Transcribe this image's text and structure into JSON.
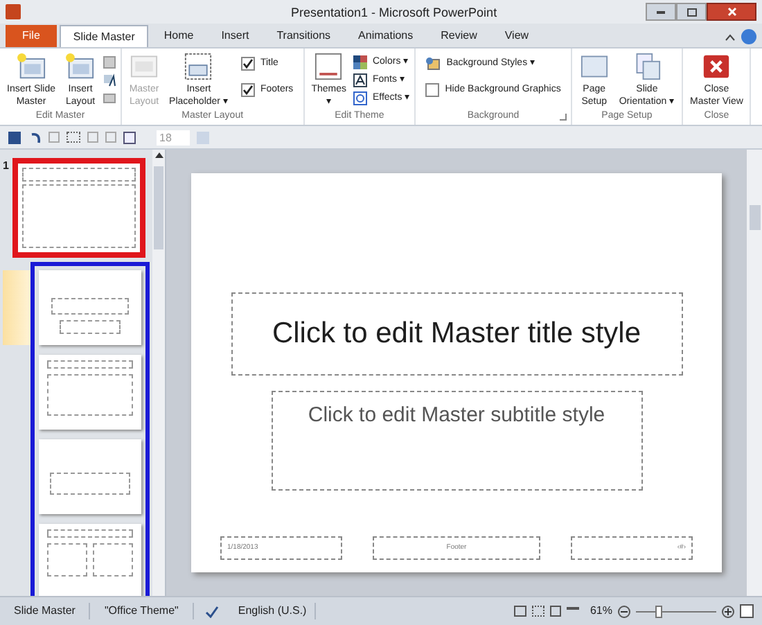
{
  "window": {
    "title": "Presentation1 - Microsoft PowerPoint"
  },
  "tabs": [
    {
      "label": "File",
      "kind": "file",
      "selected": false
    },
    {
      "label": "Slide Master",
      "kind": "tab",
      "selected": true
    },
    {
      "label": "Home",
      "kind": "tab",
      "selected": false
    },
    {
      "label": "Insert",
      "kind": "tab",
      "selected": false
    },
    {
      "label": "Transitions",
      "kind": "tab",
      "selected": false
    },
    {
      "label": "Animations",
      "kind": "tab",
      "selected": false
    },
    {
      "label": "Review",
      "kind": "tab",
      "selected": false
    },
    {
      "label": "View",
      "kind": "tab",
      "selected": false
    }
  ],
  "ribbon": {
    "groups": [
      {
        "name": "Edit Master",
        "launcher": false,
        "items": [
          {
            "kind": "large",
            "lines": [
              "Insert Slide",
              "Master"
            ],
            "disabled": false
          },
          {
            "kind": "large",
            "lines": [
              "Insert",
              "Layout"
            ],
            "disabled": false
          },
          {
            "kind": "smallicons"
          }
        ]
      },
      {
        "name": "Master Layout",
        "launcher": false,
        "items": [
          {
            "kind": "large",
            "lines": [
              "Master",
              "Layout"
            ],
            "disabled": true
          },
          {
            "kind": "large",
            "lines": [
              "Insert",
              "Placeholder ▾"
            ],
            "disabled": false
          },
          {
            "kind": "checks",
            "checks": [
              {
                "label": "Title",
                "checked": true
              },
              {
                "label": "Footers",
                "checked": true
              }
            ]
          }
        ]
      },
      {
        "name": "Edit Theme",
        "launcher": false,
        "items": [
          {
            "kind": "large",
            "lines": [
              "Themes",
              "▾"
            ],
            "disabled": false
          },
          {
            "kind": "menu",
            "entries": [
              {
                "label": "Colors ▾"
              },
              {
                "label": "Fonts ▾"
              },
              {
                "label": "Effects ▾"
              }
            ]
          }
        ]
      },
      {
        "name": "Background",
        "launcher": true,
        "items": [
          {
            "kind": "bgstack",
            "entries": [
              {
                "kind": "menu",
                "label": "Background Styles ▾"
              },
              {
                "kind": "check",
                "label": "Hide Background Graphics",
                "checked": false
              }
            ]
          }
        ]
      },
      {
        "name": "Page Setup",
        "launcher": false,
        "items": [
          {
            "kind": "large",
            "lines": [
              "Page",
              "Setup"
            ],
            "disabled": false
          },
          {
            "kind": "large",
            "lines": [
              "Slide",
              "Orientation ▾"
            ],
            "disabled": false
          }
        ]
      },
      {
        "name": "Close",
        "launcher": false,
        "items": [
          {
            "kind": "large",
            "lines": [
              "Close",
              "Master View"
            ],
            "disabled": false
          }
        ]
      }
    ]
  },
  "quick_access": {
    "font_size": "18"
  },
  "slide_panel": {
    "master": {
      "number": "1",
      "selected": true
    },
    "layouts": {
      "selected": true,
      "items": [
        {
          "kind": "title",
          "current": true
        },
        {
          "kind": "content",
          "current": false
        },
        {
          "kind": "section",
          "current": false
        },
        {
          "kind": "two",
          "current": false
        }
      ]
    }
  },
  "slide": {
    "title": "Click to edit Master title style",
    "subtitle": "Click to edit Master subtitle style",
    "date": "1/18/2013",
    "footer": "Footer",
    "page_number": "‹#›"
  },
  "status_bar": {
    "view": "Slide Master",
    "theme": "\"Office Theme\"",
    "language": "English (U.S.)",
    "zoom": "61%",
    "zoom_slider": {
      "level": 0.28
    }
  }
}
